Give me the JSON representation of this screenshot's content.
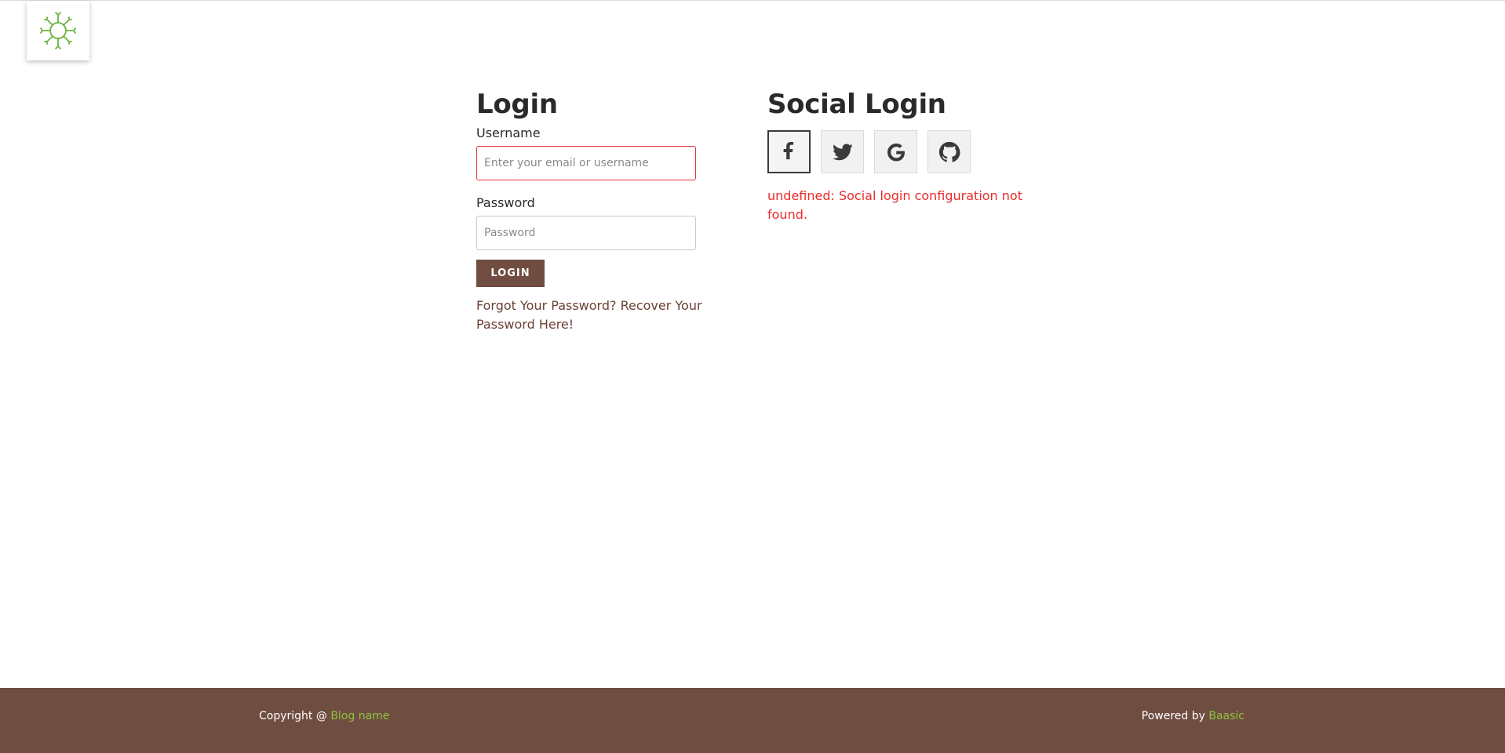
{
  "logo": {
    "icon": "sun-logo-icon",
    "color": "#6db33f"
  },
  "login": {
    "title": "Login",
    "username_label": "Username",
    "username_placeholder": "Enter your email or username",
    "username_value": "",
    "password_label": "Password",
    "password_placeholder": "Password",
    "password_value": "",
    "button_label": "LOGIN",
    "forgot_link": "Forgot Your Password? Recover Your Password Here!"
  },
  "social": {
    "title": "Social Login",
    "providers": [
      {
        "name": "facebook",
        "icon": "facebook-icon"
      },
      {
        "name": "twitter",
        "icon": "twitter-icon"
      },
      {
        "name": "google",
        "icon": "google-icon"
      },
      {
        "name": "github",
        "icon": "github-icon"
      }
    ],
    "error": "undefined: Social login configuration not found."
  },
  "footer": {
    "copyright_prefix": "Copyright @ ",
    "blog_name": "Blog name",
    "powered_prefix": "Powered by ",
    "powered_link": "Baasic"
  },
  "colors": {
    "brand": "#704d41",
    "accent": "#8cc63e",
    "error": "#ec2a2a"
  }
}
